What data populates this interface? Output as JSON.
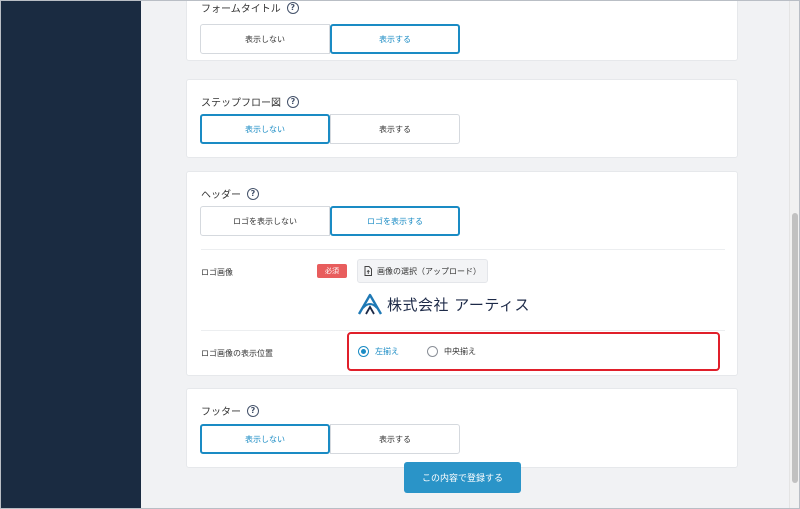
{
  "sections": {
    "form_title": {
      "title": "フォームタイトル",
      "options": [
        "表示しない",
        "表示する"
      ],
      "selected": 1
    },
    "step_flow": {
      "title": "ステップフロー図",
      "options": [
        "表示しない",
        "表示する"
      ],
      "selected": 0
    },
    "header": {
      "title": "ヘッダー",
      "options": [
        "ロゴを表示しない",
        "ロゴを表示する"
      ],
      "selected": 1,
      "logo_label": "ロゴ画像",
      "required_badge": "必須",
      "upload_label": "画像の選択（アップロード）",
      "logo_text": "株式会社 アーティス",
      "position_label": "ロゴ画像の表示位置",
      "position_options": [
        "左揃え",
        "中央揃え"
      ],
      "position_selected": 0
    },
    "footer": {
      "title": "フッター",
      "options": [
        "表示しない",
        "表示する"
      ],
      "selected": 0
    }
  },
  "help_glyph": "?",
  "submit_label": "この内容で登録する",
  "colors": {
    "sidebar": "#1a2b41",
    "accent": "#1a8bc4",
    "required": "#e85d5d",
    "highlight": "#e01f2a",
    "submit": "#2a94c8"
  }
}
